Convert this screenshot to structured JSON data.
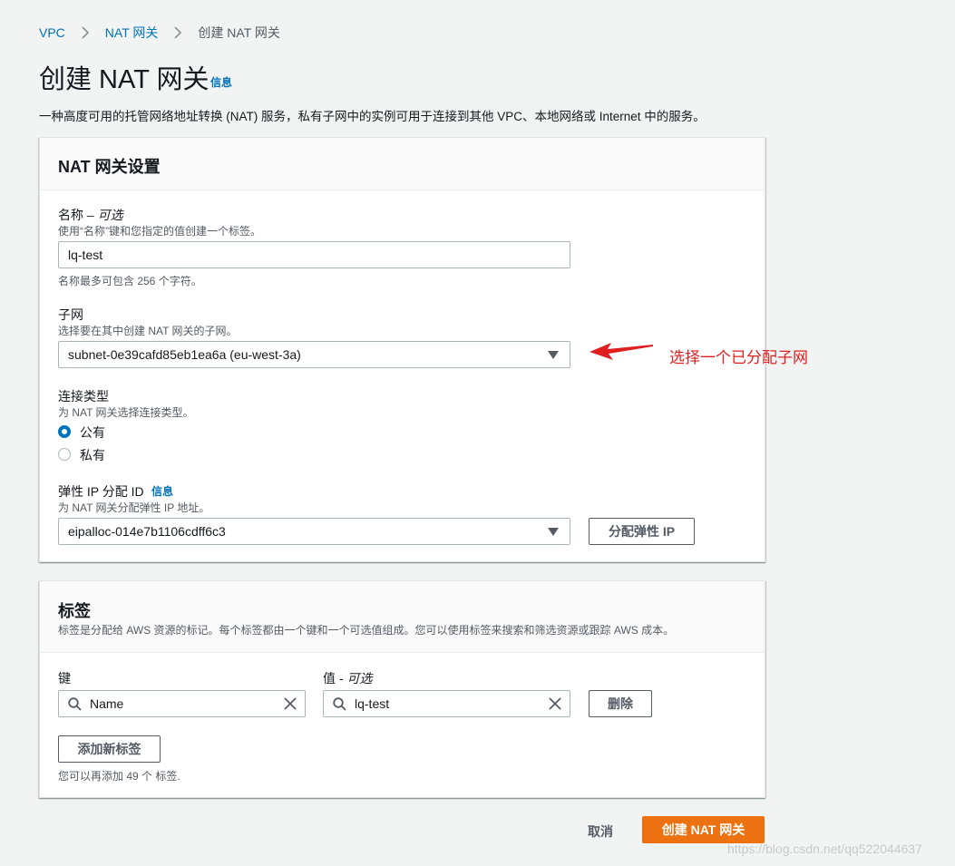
{
  "breadcrumb": {
    "items": [
      "VPC",
      "NAT 网关",
      "创建 NAT 网关"
    ]
  },
  "page": {
    "title": "创建 NAT 网关",
    "info_link": "信息",
    "description": "一种高度可用的托管网络地址转换 (NAT) 服务，私有子网中的实例可用于连接到其他 VPC、本地网络或 Internet 中的服务。"
  },
  "settings_panel": {
    "title": "NAT 网关设置",
    "name_field": {
      "label": "名称",
      "label_optional": "– 可选",
      "hint": "使用“名称”键和您指定的值创建一个标签。",
      "value": "lq-test",
      "constraint": "名称最多可包含 256 个字符。"
    },
    "subnet_field": {
      "label": "子网",
      "hint": "选择要在其中创建 NAT 网关的子网。",
      "selected": "subnet-0e39cafd85eb1ea6a (eu-west-3a)"
    },
    "connectivity_field": {
      "label": "连接类型",
      "hint": "为 NAT 网关选择连接类型。",
      "options": [
        {
          "label": "公有",
          "selected": true
        },
        {
          "label": "私有",
          "selected": false
        }
      ]
    },
    "eip_field": {
      "label": "弹性 IP 分配 ID",
      "info_link": "信息",
      "hint": "为 NAT 网关分配弹性 IP 地址。",
      "selected": "eipalloc-014e7b1106cdff6c3",
      "allocate_button": "分配弹性 IP"
    }
  },
  "tags_panel": {
    "title": "标签",
    "description": "标签是分配给 AWS 资源的标记。每个标签都由一个键和一个可选值组成。您可以使用标签来搜索和筛选资源或跟踪 AWS 成本。",
    "key_label": "键",
    "value_label": "值",
    "value_label_optional": "- 可选",
    "tag": {
      "key": "Name",
      "value": "lq-test"
    },
    "remove_button": "删除",
    "add_button": "添加新标签",
    "remaining": "您可以再添加 49 个 标签."
  },
  "footer": {
    "cancel": "取消",
    "submit": "创建 NAT 网关"
  },
  "annotation": {
    "text": "选择一个已分配子网",
    "color": "#e02020"
  },
  "watermark": "https://blog.csdn.net/qq522044637",
  "colors": {
    "link": "#0073bb",
    "primary": "#ec7211",
    "background": "#f2f3f3"
  }
}
